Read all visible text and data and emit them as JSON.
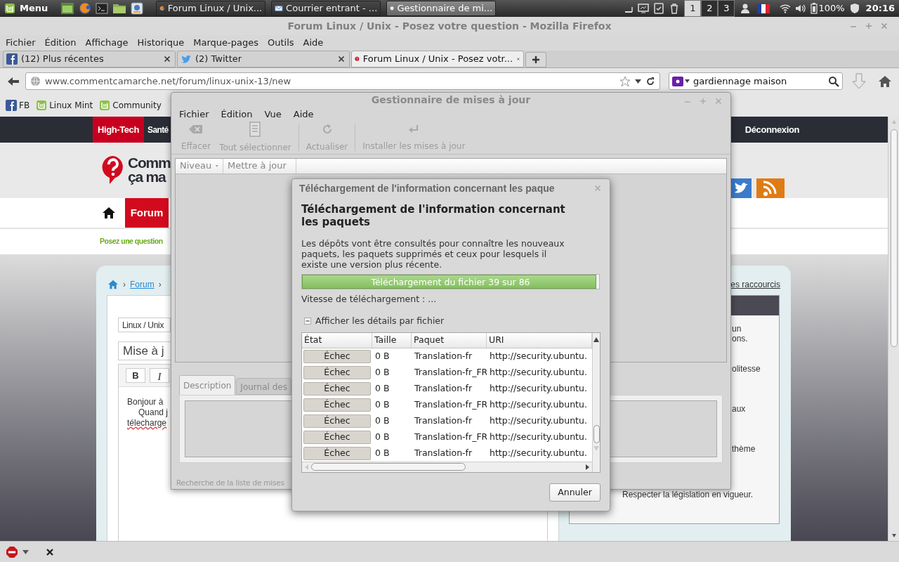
{
  "panel": {
    "menu": "Menu",
    "tasks": [
      {
        "label": "Forum Linux / Unix...",
        "kind": "browser",
        "selected": false
      },
      {
        "label": "Courrier entrant - ...",
        "kind": "mail",
        "selected": false
      },
      {
        "label": "Gestionnaire de mi...",
        "kind": "shield",
        "selected": true
      }
    ],
    "workspaces": [
      {
        "label": "1",
        "selected": true
      },
      {
        "label": "2",
        "selected": false
      },
      {
        "label": "3",
        "selected": false
      }
    ],
    "battery": "100%",
    "clock": "20:16"
  },
  "browser": {
    "title": "Forum Linux / Unix - Posez votre question - Mozilla Firefox",
    "menu": [
      "Fichier",
      "Édition",
      "Affichage",
      "Historique",
      "Marque-pages",
      "Outils",
      "Aide"
    ],
    "tabs": [
      {
        "label": "(12) Plus récentes",
        "kind": "facebook",
        "selected": false
      },
      {
        "label": "(2) Twitter",
        "kind": "twitter",
        "selected": false
      },
      {
        "label": "Forum Linux / Unix - Posez votr...",
        "kind": "question",
        "selected": true
      }
    ],
    "url": "www.commentcamarche.net/forum/linux-unix-13/new",
    "search": {
      "value": "gardiennage maison"
    },
    "bookmarks": [
      {
        "label": "FB",
        "kind": "facebook"
      },
      {
        "label": "Linux Mint",
        "kind": "mint"
      },
      {
        "label": "Community",
        "kind": "mint"
      }
    ]
  },
  "page": {
    "nav": [
      {
        "label": "High-Tech",
        "selected": true
      },
      {
        "label": "Santé",
        "selected": false
      }
    ],
    "logout": "Déconnexion",
    "logo": [
      "Comm",
      "ça ma"
    ],
    "section": "Forum",
    "ask": "Posez une question",
    "breadcrumb": [
      {
        "text": "›",
        "kind": "separator"
      },
      {
        "text": "Forum",
        "kind": "link"
      },
      {
        "text": "›",
        "kind": "separator"
      }
    ],
    "shortcuts": "es raccourcis",
    "category": "Linux / Unix",
    "subject": "Mise à j",
    "format_buttons": [
      {
        "label": "B",
        "kind": "bold"
      },
      {
        "label": "I",
        "kind": "italic"
      }
    ],
    "body": [
      {
        "text": "Bonjour à",
        "indented": false,
        "misspelled": false
      },
      {
        "text": "Quand j",
        "indented": true,
        "misspelled": false
      },
      {
        "text": "télecharge",
        "indented": false,
        "misspelled": true
      }
    ],
    "rules": [
      {
        "lines": [
          "un",
          "ons."
        ],
        "kind": "fragment"
      },
      {
        "lines": [
          "olitesse"
        ],
        "kind": "fragment"
      },
      {
        "lines": [
          "aux"
        ],
        "kind": "fragment"
      },
      {
        "lines": [
          "thème"
        ],
        "kind": "fragment"
      },
      {
        "lines": [
          "Respecter la législation en vigueur."
        ],
        "kind": "full"
      }
    ]
  },
  "update_manager": {
    "title": "Gestionnaire de mises à jour",
    "menu": [
      "Fichier",
      "Édition",
      "Vue",
      "Aide"
    ],
    "toolbar": [
      {
        "label": "Effacer",
        "kind": "clear",
        "disabled": true
      },
      {
        "label": "Tout sélectionner",
        "kind": "select",
        "disabled": true
      },
      {
        "label": "Actualiser",
        "kind": "refresh",
        "disabled": true
      },
      {
        "label": "Installer les mises à jour",
        "kind": "install",
        "disabled": true
      }
    ],
    "columns": [
      {
        "label": "Niveau",
        "sorted": true
      },
      {
        "label": "Mettre à jour",
        "sorted": false
      }
    ],
    "tabs": [
      {
        "label": "Description",
        "selected": true
      },
      {
        "label": "Journal des",
        "selected": false
      }
    ],
    "status": "Recherche de la liste de mises"
  },
  "dialog": {
    "title": "Téléchargement de l'information concernant les paque",
    "heading": "Téléchargement de l'information concernant les paquets",
    "description": "Les dépôts vont être consultés pour connaître les nouveaux paquets, les paquets supprimés et ceux pour lesquels il existe une version plus récente.",
    "progress": {
      "level": 0.99,
      "label": "Téléchargement du fichier 39 sur 86"
    },
    "speed": "Vitesse de téléchargement : ...",
    "details": {
      "label": "Afficher les détails par fichier",
      "expanded": true
    },
    "table": {
      "columns": [
        "État",
        "Taille",
        "Paquet",
        "URI"
      ],
      "rows": [
        [
          "Échec",
          "0 B",
          "Translation-fr",
          "http://security.ubuntu."
        ],
        [
          "Échec",
          "0 B",
          "Translation-fr_FR",
          "http://security.ubuntu."
        ],
        [
          "Échec",
          "0 B",
          "Translation-fr",
          "http://security.ubuntu."
        ],
        [
          "Échec",
          "0 B",
          "Translation-fr_FR",
          "http://security.ubuntu."
        ],
        [
          "Échec",
          "0 B",
          "Translation-fr",
          "http://security.ubuntu."
        ],
        [
          "Échec",
          "0 B",
          "Translation-fr_FR",
          "http://security.ubuntu."
        ],
        [
          "Échec",
          "0 B",
          "Translation-fr",
          "http://security.ubuntu."
        ]
      ]
    },
    "buttons": [
      "Annuler"
    ]
  }
}
